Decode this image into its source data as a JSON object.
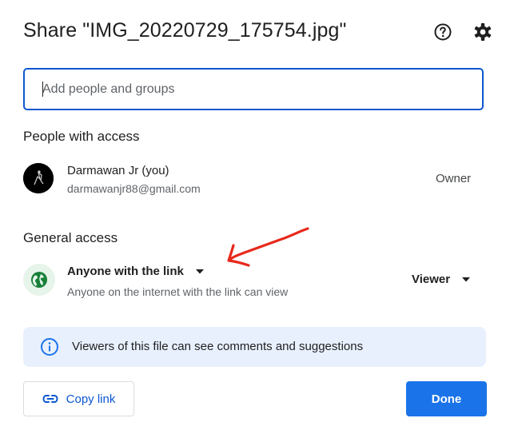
{
  "dialog": {
    "title": "Share \"IMG_20220729_175754.jpg\""
  },
  "header": {
    "help_icon": "help-circle-icon",
    "settings_icon": "gear-icon"
  },
  "add_people": {
    "placeholder": "Add people and groups",
    "value": ""
  },
  "people_with_access": {
    "heading": "People with access",
    "people": [
      {
        "name": "Darmawan Jr (you)",
        "email": "darmawanjr88@gmail.com",
        "role": "Owner"
      }
    ]
  },
  "general_access": {
    "heading": "General access",
    "access_option": "Anyone with the link",
    "access_description": "Anyone on the internet with the link can view",
    "role": "Viewer",
    "icon": "globe-icon"
  },
  "info_banner": {
    "text": "Viewers of this file can see comments and suggestions",
    "icon": "info-icon"
  },
  "footer": {
    "copy_link_label": "Copy link",
    "done_label": "Done"
  },
  "colors": {
    "accent": "#0b57d0",
    "primary_button": "#1a73e8",
    "banner_bg": "#e8f0fe",
    "globe_bg": "#e6f4ea",
    "globe_fg": "#188038",
    "annotation_arrow": "#e8291c"
  }
}
